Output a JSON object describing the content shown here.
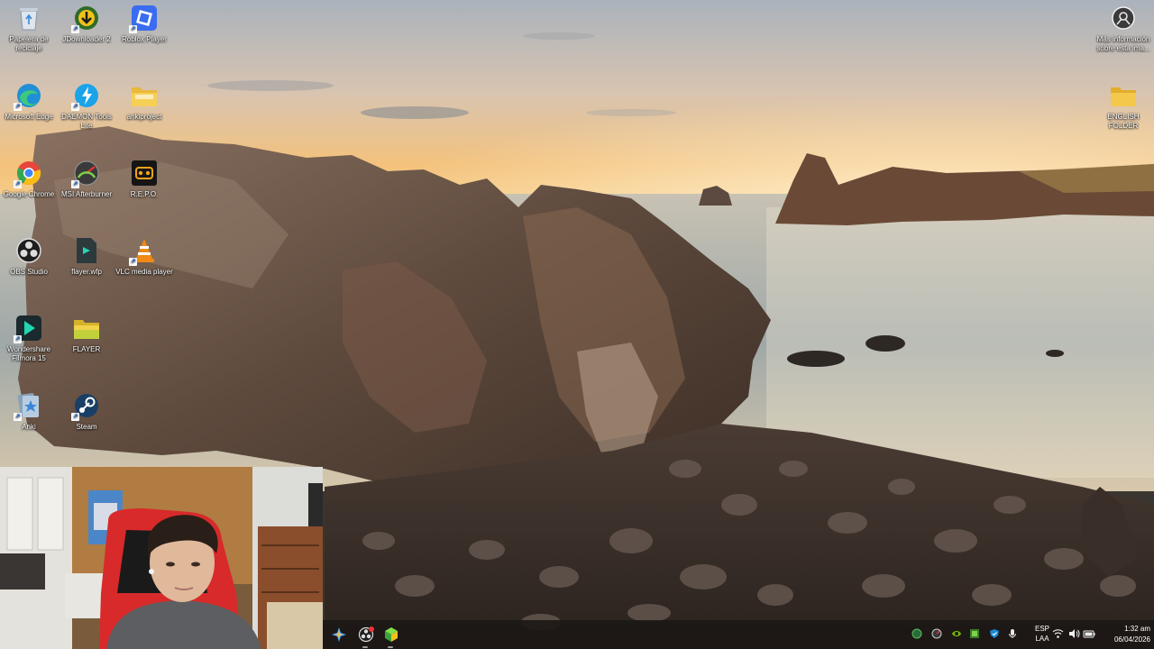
{
  "desktop": {
    "icons": [
      {
        "label": "Papelera de reciclaje",
        "icon": "recycle-bin-icon"
      },
      {
        "label": "JDownloader 2",
        "icon": "jdownloader-icon"
      },
      {
        "label": "Roblox Player",
        "icon": "roblox-icon"
      },
      {
        "label": "Microsoft Edge",
        "icon": "edge-icon"
      },
      {
        "label": "DAEMON Tools Lite",
        "icon": "daemon-tools-icon"
      },
      {
        "label": "ankiproject",
        "icon": "folder-icon"
      },
      {
        "label": "Google Chrome",
        "icon": "chrome-icon"
      },
      {
        "label": "MSI Afterburner",
        "icon": "msi-afterburner-icon"
      },
      {
        "label": "R.E.P.O.",
        "icon": "repo-game-icon"
      },
      {
        "label": "OBS Studio",
        "icon": "obs-icon"
      },
      {
        "label": "flayer.wfp",
        "icon": "filmora-project-file-icon"
      },
      {
        "label": "VLC media player",
        "icon": "vlc-icon"
      },
      {
        "label": "Wondershare Filmora 15",
        "icon": "filmora-icon"
      },
      {
        "label": "FLAYER",
        "icon": "folder-icon"
      },
      {
        "label": "Anki",
        "icon": "anki-icon"
      },
      {
        "label": "Steam",
        "icon": "steam-icon"
      }
    ],
    "right_icons": [
      {
        "label": "Más información sobre esta ima...",
        "icon": "camera-info-icon"
      },
      {
        "label": "ENGLISH FOLDER",
        "icon": "folder-icon"
      }
    ]
  },
  "taskbar": {
    "apps": [
      "copilot-icon",
      "obs-taskbar-icon",
      "app-cube-icon"
    ],
    "tray": [
      "shield-icon",
      "msi-tray-icon",
      "nvidia-icon",
      "gpu-icon",
      "defender-icon",
      "microphone-icon"
    ],
    "language": {
      "line1": "ESP",
      "line2": "LAA"
    },
    "system_icons": [
      "wifi-icon",
      "volume-icon",
      "battery-icon"
    ],
    "clock": {
      "time": "1:32 am",
      "date": "06/04/2026"
    }
  },
  "colors": {
    "sky_top": "#b8bcc4",
    "sunset": "#f6c070",
    "sea": "#8aa4b0",
    "rock": "#5c4a3e",
    "taskbar": "#1c1816"
  }
}
